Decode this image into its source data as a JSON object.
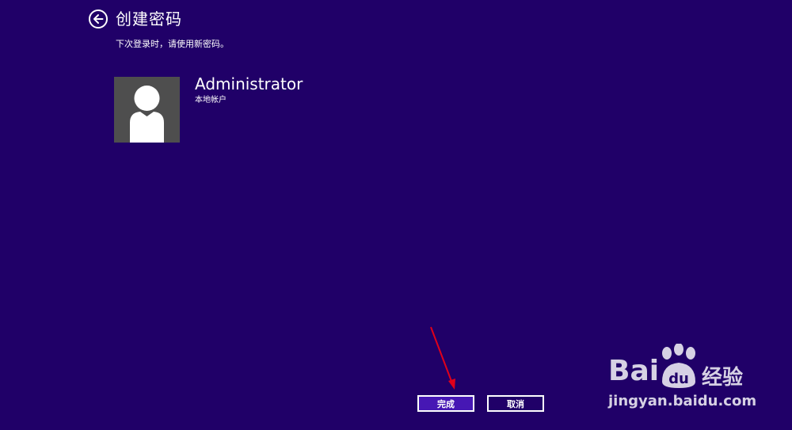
{
  "header": {
    "title": "创建密码",
    "back_icon": "arrow-left-icon"
  },
  "subtitle": "下次登录时，请使用新密码。",
  "account": {
    "name": "Administrator",
    "type": "本地帐户",
    "avatar_icon": "user-silhouette-icon"
  },
  "buttons": {
    "finish_label": "完成",
    "cancel_label": "取消"
  },
  "watermark": {
    "brand_left": "Bai",
    "brand_right": "du",
    "product": "经验",
    "url": "jingyan.baidu.com"
  },
  "colors": {
    "background": "#200068",
    "primary_button": "#4617b4",
    "annotation_arrow": "#e0001a"
  }
}
